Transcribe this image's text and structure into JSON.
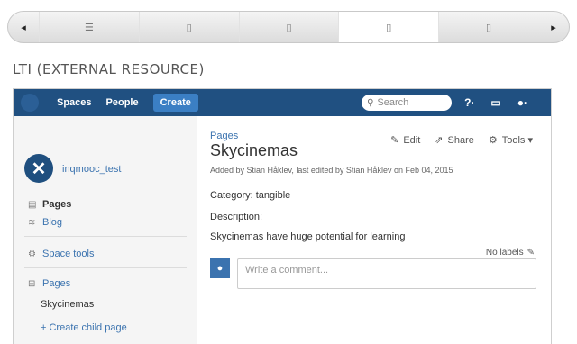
{
  "carousel": {
    "prev_icon": "◂",
    "next_icon": "▸",
    "slots": [
      "☰",
      "▯",
      "▯",
      "▯",
      "▯"
    ]
  },
  "section_title": "LTI (EXTERNAL RESOURCE)",
  "navbar": {
    "spaces": "Spaces",
    "people": "People",
    "create": "Create",
    "search_placeholder": "Search",
    "help_icon": "?·",
    "notifications_icon": "▭",
    "user_icon": "●·"
  },
  "sidebar": {
    "space_name": "inqmooc_test",
    "pages": "Pages",
    "blog": "Blog",
    "space_tools": "Space tools",
    "tree_root": "Pages",
    "tree_child": "Skycinemas",
    "create_child": "+ Create child page"
  },
  "page": {
    "breadcrumb": "Pages",
    "title": "Skycinemas",
    "meta": "Added by Stian Håklev, last edited by Stian Håklev on Feb 04, 2015",
    "edit": "Edit",
    "share": "Share",
    "tools": "Tools ▾",
    "category": "Category: tangible",
    "description_label": "Description:",
    "description_text": "Skycinemas have huge potential for learning",
    "labels": "No labels",
    "comment_placeholder": "Write a comment..."
  }
}
